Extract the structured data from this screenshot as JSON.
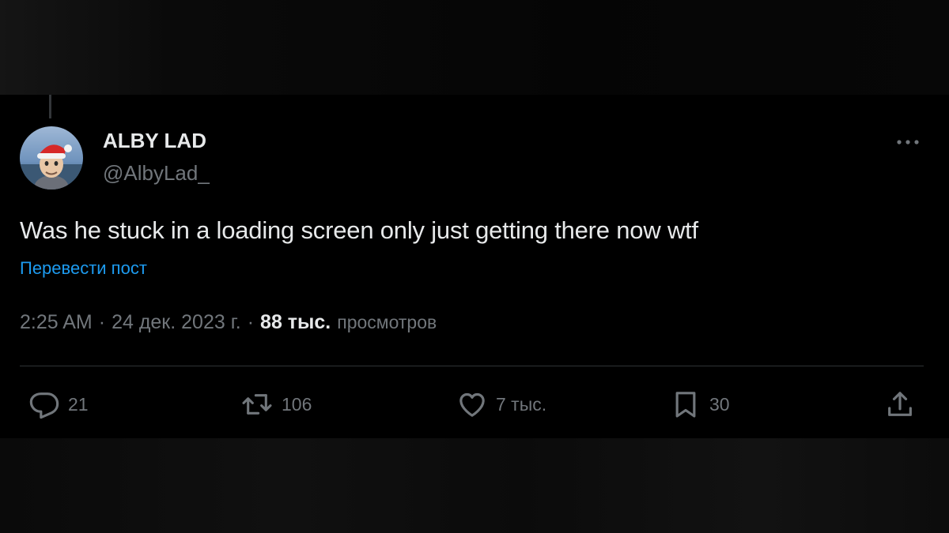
{
  "author": {
    "name": "ALBY LAD",
    "handle": "@AlbyLad_"
  },
  "tweet": {
    "text": "Was he stuck in a loading screen only just getting there now wtf",
    "translate_label": "Перевести пост"
  },
  "meta": {
    "time": "2:25 AM",
    "separator": "·",
    "date": "24 дек. 2023 г.",
    "views_count": "88 тыс.",
    "views_label": "просмотров"
  },
  "actions": {
    "replies": "21",
    "reposts": "106",
    "likes": "7 тыс.",
    "bookmarks": "30"
  },
  "icons": {
    "more": "more-horizontal-icon",
    "reply": "reply-icon",
    "repost": "repost-icon",
    "like": "heart-icon",
    "bookmark": "bookmark-icon",
    "share": "share-icon"
  },
  "colors": {
    "background": "#000000",
    "text": "#e7e9ea",
    "secondary_text": "#71767b",
    "link": "#1d9bf0",
    "divider": "#2f3336"
  }
}
